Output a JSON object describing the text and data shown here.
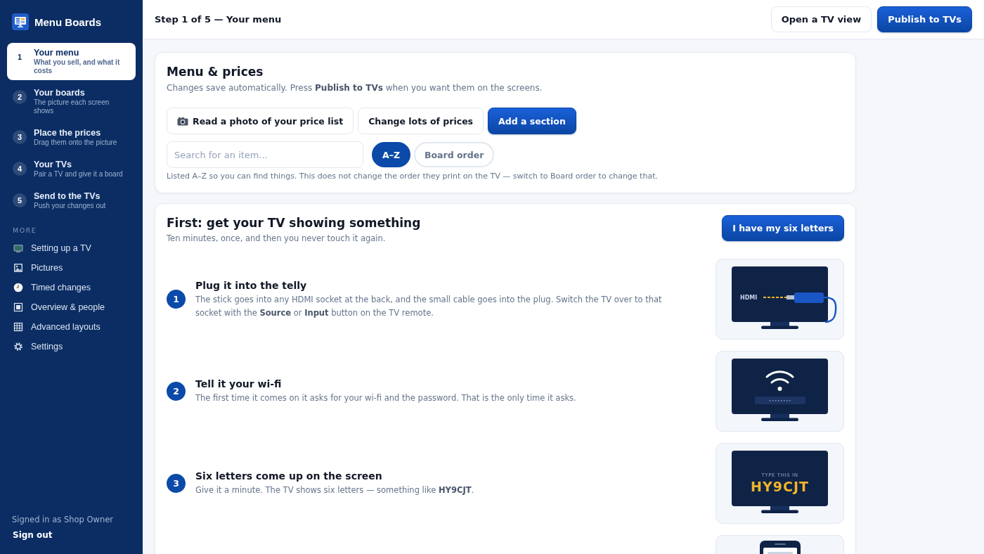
{
  "app": {
    "name": "Menu Boards"
  },
  "sidebar": {
    "steps": [
      {
        "number": "1",
        "title": "Your menu",
        "subtitle": "What you sell, and what it costs",
        "selected": true
      },
      {
        "number": "2",
        "title": "Your boards",
        "subtitle": "The picture each screen shows",
        "selected": false
      },
      {
        "number": "3",
        "title": "Place the prices",
        "subtitle": "Drag them onto the picture",
        "selected": false
      },
      {
        "number": "4",
        "title": "Your TVs",
        "subtitle": "Pair a TV and give it a board",
        "selected": false
      },
      {
        "number": "5",
        "title": "Send to the TVs",
        "subtitle": "Push your changes out",
        "selected": false
      }
    ],
    "more_heading": "MORE",
    "more_items": [
      {
        "label": "Setting up a TV",
        "kind": "tv"
      },
      {
        "label": "Pictures",
        "kind": "picture"
      },
      {
        "label": "Timed changes",
        "kind": "clock"
      },
      {
        "label": "Overview & people",
        "kind": "square"
      },
      {
        "label": "Advanced layouts",
        "kind": "grid"
      },
      {
        "label": "Settings",
        "kind": "gear"
      }
    ],
    "signed_in": "Signed in as Shop Owner",
    "sign_out": "Sign out"
  },
  "header": {
    "title": "Step 1 of 5 — Your menu",
    "buttons": [
      {
        "label": "Open a TV view",
        "kind": "outline"
      },
      {
        "label": "Publish to TVs",
        "kind": "primary"
      }
    ]
  },
  "menu_card": {
    "title": "Menu & prices",
    "subtitle": "Changes save automatically. Press **Publish to TVs** when you want them on the screens.",
    "actions": [
      {
        "label": "Read a photo of your price list",
        "kind": "camera"
      },
      {
        "label": "Change lots of prices",
        "kind": "outline"
      },
      {
        "label": "Add a section",
        "kind": "primary"
      }
    ],
    "search": {
      "placeholder": "Search for an item..."
    },
    "sort_options": [
      {
        "label": "A–Z",
        "selected": true
      },
      {
        "label": "Board order",
        "selected": false
      }
    ],
    "note": "Listed A–Z so you can find things. This does not change the order they print on the TV — switch to Board order to change that."
  },
  "setup_card": {
    "title": "First: get your TV showing something",
    "subtitle": "Ten minutes, once, and then you never touch it again.",
    "button": "I have my six letters",
    "steps": [
      {
        "number": "1",
        "title": "Plug it into the telly",
        "text": "The stick goes into any HDMI socket at the back, and the small cable goes into the plug. Switch the TV over to that socket with the **Source** or **Input** button on the TV remote.",
        "illustration": {
          "kind": "hdmi",
          "label": "HDMI"
        }
      },
      {
        "number": "2",
        "title": "Tell it your wi-fi",
        "text": "The first time it comes on it asks for your wi-fi and the password. That is the only time it asks.",
        "illustration": {
          "kind": "wifi",
          "password": "••••••••"
        }
      },
      {
        "number": "3",
        "title": "Six letters come up on the screen",
        "text": "Give it a minute. The TV shows six letters — something like **HY9CJT**.",
        "illustration": {
          "kind": "code",
          "caption": "TYPE THIS IN",
          "code": "HY9CJT"
        }
      },
      {
        "illustration": {
          "kind": "phone"
        }
      }
    ]
  }
}
